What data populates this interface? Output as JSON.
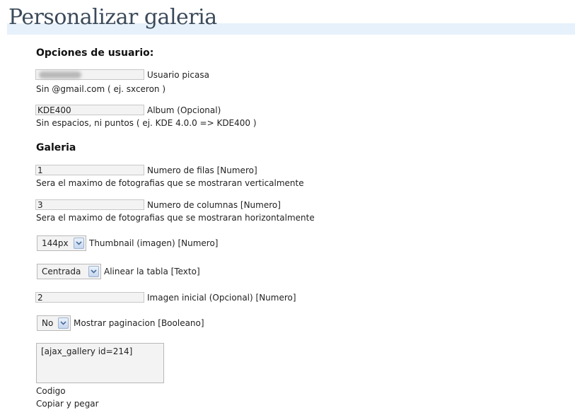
{
  "page": {
    "title": "Personalizar galeria"
  },
  "user_options": {
    "heading": "Opciones de usuario:",
    "picasa_user": {
      "value": "",
      "label": "Usuario picasa",
      "hint": "Sin @gmail.com ( ej. sxceron )"
    },
    "album": {
      "value": "KDE400",
      "label": "Album (Opcional)",
      "hint": "Sin espacios, ni puntos ( ej. KDE 4.0.0 => KDE400 )"
    }
  },
  "gallery": {
    "heading": "Galeria",
    "rows": {
      "value": "1",
      "label": "Numero de filas [Numero]",
      "hint": "Sera el maximo de fotografias que se mostraran verticalmente"
    },
    "columns": {
      "value": "3",
      "label": "Numero de columnas [Numero]",
      "hint": "Sera el maximo de fotografias que se mostraran horizontalmente"
    },
    "thumbnail": {
      "selected": "144px",
      "label": "Thumbnail (imagen) [Numero]"
    },
    "align": {
      "selected": "Centrada",
      "label": "Alinear la tabla [Texto]"
    },
    "start_image": {
      "value": "2",
      "label": "Imagen inicial (Opcional) [Numero]"
    },
    "pagination": {
      "selected": "No",
      "label": "Mostrar paginacion [Booleano]"
    },
    "code": {
      "value": "[ajax_gallery id=214]",
      "label": "Codigo",
      "hint": "Copiar y pegar"
    }
  }
}
